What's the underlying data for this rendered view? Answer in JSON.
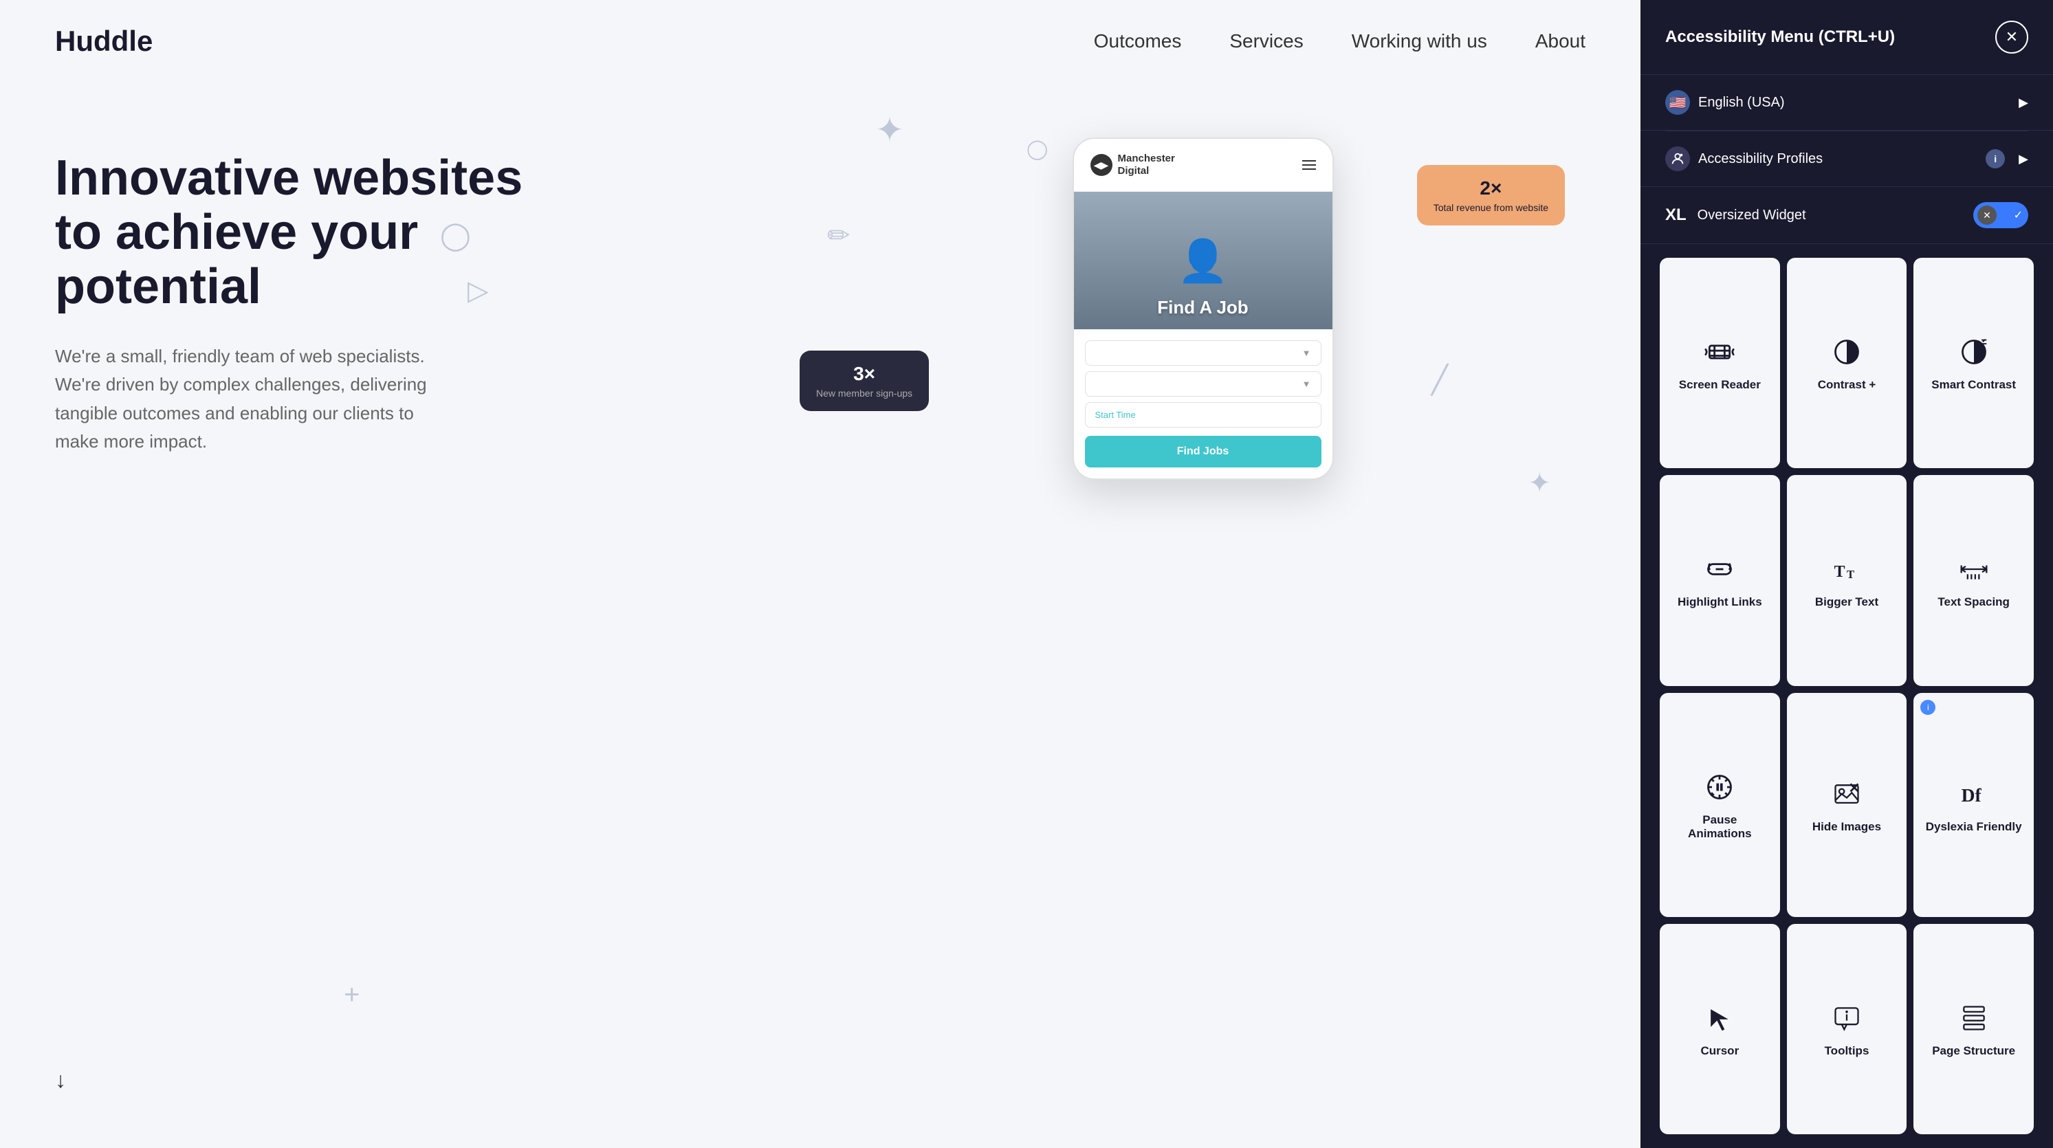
{
  "website": {
    "logo": "Huddle",
    "nav": {
      "links": [
        "Outcomes",
        "Services",
        "Working with us",
        "About"
      ]
    },
    "hero": {
      "title": "Innovative websites to achieve your potential",
      "subtitle": "We're a small, friendly team of web specialists. We're driven by complex challenges, delivering tangible outcomes and enabling our clients to make more impact."
    },
    "phone": {
      "logo_name": "Manchester\nDigital",
      "hero_text": "Find A Job",
      "cta_button": "Find Jobs",
      "input1_placeholder": "",
      "input2_placeholder": "",
      "input3_text": "Start Time"
    },
    "bubble_orange": {
      "number": "2×",
      "label": "Total revenue from website"
    },
    "bubble_dark": {
      "number": "3×",
      "label": "New member sign-ups"
    }
  },
  "accessibility_panel": {
    "title": "Accessibility Menu (CTRL+U)",
    "close_label": "×",
    "language": {
      "text": "English (USA)",
      "chevron": "▶"
    },
    "profiles": {
      "text": "Accessibility Profiles",
      "chevron": "▶",
      "info": "i"
    },
    "oversized_widget": {
      "xl_label": "XL",
      "text": "Oversized Widget"
    },
    "features": [
      {
        "id": "screen-reader",
        "label": "Screen Reader",
        "icon": "screen-reader",
        "has_info": false
      },
      {
        "id": "contrast-plus",
        "label": "Contrast +",
        "icon": "contrast",
        "has_info": false
      },
      {
        "id": "smart-contrast",
        "label": "Smart Contrast",
        "icon": "smart-contrast",
        "has_info": false
      },
      {
        "id": "highlight-links",
        "label": "Highlight Links",
        "icon": "link",
        "has_info": false
      },
      {
        "id": "bigger-text",
        "label": "Bigger Text",
        "icon": "bigger-text",
        "has_info": false
      },
      {
        "id": "text-spacing",
        "label": "Text Spacing",
        "icon": "text-spacing",
        "has_info": false
      },
      {
        "id": "pause-animations",
        "label": "Pause Animations",
        "icon": "pause",
        "has_info": false
      },
      {
        "id": "hide-images",
        "label": "Hide Images",
        "icon": "hide-images",
        "has_info": false
      },
      {
        "id": "dyslexia-friendly",
        "label": "Dyslexia Friendly",
        "icon": "dyslexia",
        "has_info": true
      },
      {
        "id": "cursor",
        "label": "Cursor",
        "icon": "cursor",
        "has_info": false
      },
      {
        "id": "tooltips",
        "label": "Tooltips",
        "icon": "tooltips",
        "has_info": false
      },
      {
        "id": "page-structure",
        "label": "Page Structure",
        "icon": "page-structure",
        "has_info": false
      }
    ]
  }
}
